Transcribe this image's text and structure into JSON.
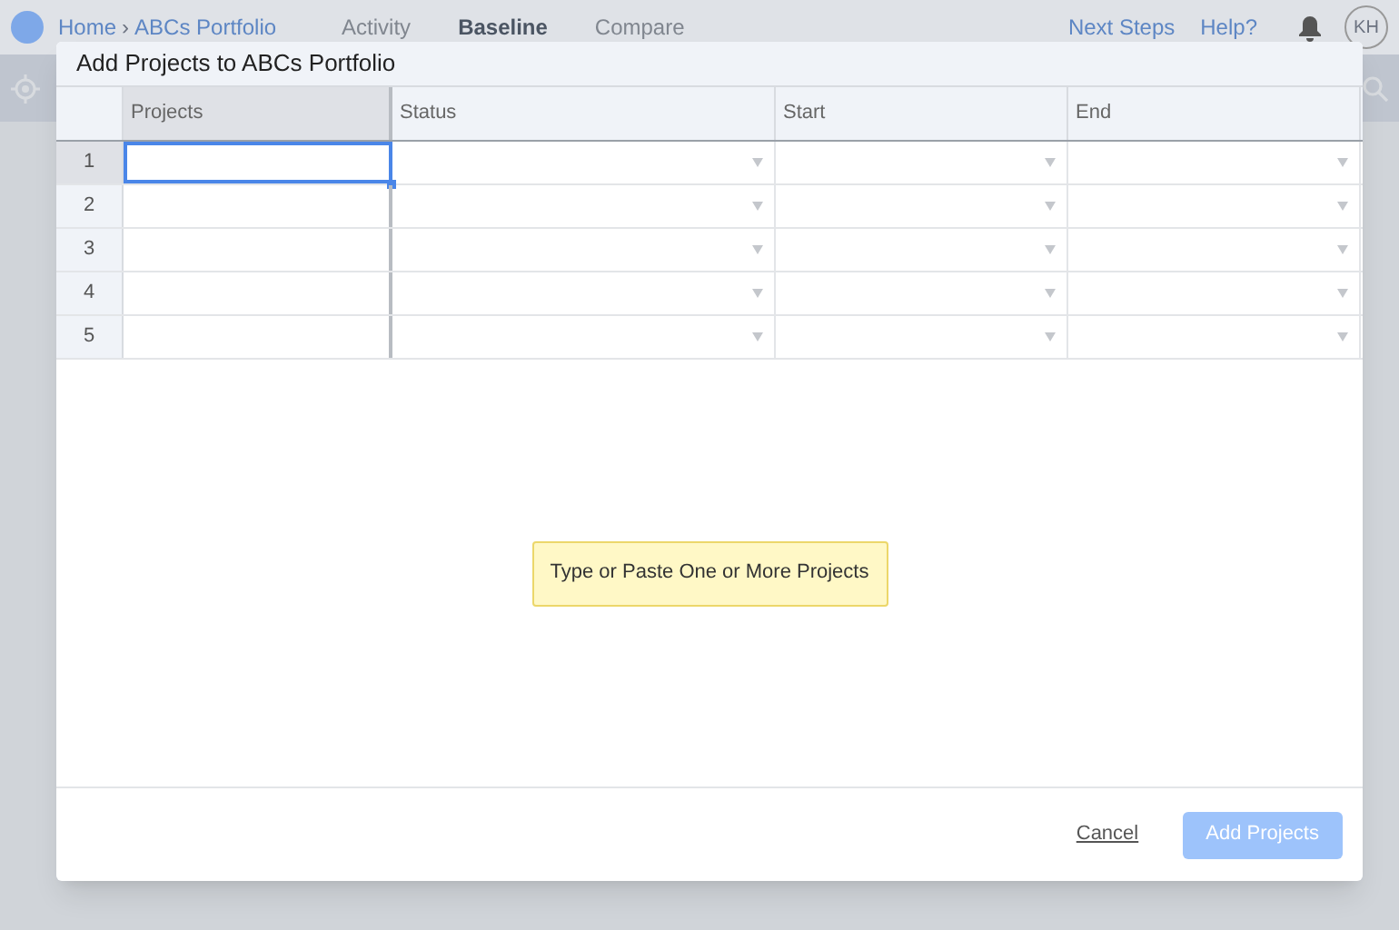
{
  "app_nav": {
    "breadcrumb": [
      "Home",
      "ABCs Portfolio"
    ],
    "breadcrumb_separator": "›",
    "tabs": [
      {
        "label": "Activity",
        "selected": false
      },
      {
        "label": "Baseline",
        "selected": true
      },
      {
        "label": "Compare",
        "selected": false
      }
    ],
    "links": [
      "Next Steps",
      "Help?"
    ],
    "avatar": "KH"
  },
  "dialog": {
    "title": "Add Projects to ABCs Portfolio",
    "table": {
      "columns": [
        {
          "label": "Projects",
          "kind": "text",
          "selected": true
        },
        {
          "label": "Status",
          "kind": "dropdown",
          "selected": false
        },
        {
          "label": "Start",
          "kind": "dropdown",
          "selected": false
        },
        {
          "label": "End",
          "kind": "dropdown",
          "selected": false
        }
      ],
      "rows": [
        {
          "number": "1",
          "selected": true
        },
        {
          "number": "2",
          "selected": false
        },
        {
          "number": "3",
          "selected": false
        },
        {
          "number": "4",
          "selected": false
        },
        {
          "number": "5",
          "selected": false
        }
      ]
    },
    "hint": "Type or Paste One or More Projects",
    "buttons": [
      {
        "label": "Cancel",
        "kind": "link",
        "disabled": false
      },
      {
        "label": "Add Projects",
        "kind": "primary",
        "disabled": true
      }
    ]
  }
}
